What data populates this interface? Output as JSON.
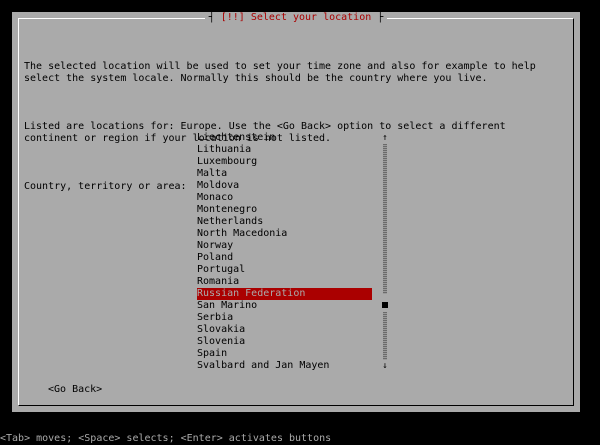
{
  "dialog": {
    "title": "[!!] Select your location",
    "paragraphs": [
      "The selected location will be used to set your time zone and also for example to help\nselect the system locale. Normally this should be the country where you live.",
      "Listed are locations for: Europe. Use the <Go Back> option to select a different\ncontinent or region if your location is not listed.",
      "Country, territory or area:"
    ],
    "items": [
      "Liechtenstein",
      "Lithuania",
      "Luxembourg",
      "Malta",
      "Moldova",
      "Monaco",
      "Montenegro",
      "Netherlands",
      "North Macedonia",
      "Norway",
      "Poland",
      "Portugal",
      "Romania",
      "Russian Federation",
      "San Marino",
      "Serbia",
      "Slovakia",
      "Slovenia",
      "Spain",
      "Svalbard and Jan Mayen"
    ],
    "selected_item": "Russian Federation",
    "go_back_label": "<Go Back>",
    "scroll_up_icon": "↑",
    "scroll_down_icon": "↓"
  },
  "statusbar": {
    "text": "<Tab> moves; <Space> selects; <Enter> activates buttons"
  },
  "colors": {
    "background": "#000000",
    "dialog": "#aaaaaa",
    "title": "#aa0000",
    "selection": "#aa0000"
  }
}
